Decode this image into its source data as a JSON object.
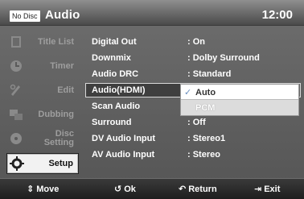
{
  "header": {
    "disc_status": "No Disc",
    "title": "Audio",
    "clock": "12:00"
  },
  "sidebar": {
    "items": [
      {
        "label": "Title List",
        "icon": "title-list-icon"
      },
      {
        "label": "Timer",
        "icon": "timer-icon"
      },
      {
        "label": "Edit",
        "icon": "edit-icon"
      },
      {
        "label": "Dubbing",
        "icon": "dubbing-icon"
      },
      {
        "label_line1": "Disc",
        "label_line2": "Setting",
        "icon": "disc-setting-icon"
      },
      {
        "label": "Setup",
        "icon": "gear-icon",
        "active": true
      }
    ]
  },
  "menu": {
    "rows": [
      {
        "key": "Digital Out",
        "value": ": On"
      },
      {
        "key": "Downmix",
        "value": ": Dolby Surround"
      },
      {
        "key": "Audio DRC",
        "value": ": Standard"
      },
      {
        "key": "Audio(HDMI)",
        "value": "",
        "selected": true
      },
      {
        "key": "Scan Audio",
        "value": ""
      },
      {
        "key": "Surround",
        "value": ": Off"
      },
      {
        "key": "DV Audio Input",
        "value": ": Stereo1"
      },
      {
        "key": "AV Audio Input",
        "value": ": Stereo"
      }
    ]
  },
  "dropdown": {
    "options": [
      {
        "label": "Auto",
        "checked": true
      },
      {
        "label": "PCM",
        "checked": false
      }
    ]
  },
  "footer": {
    "move": "Move",
    "ok": "Ok",
    "return": "Return",
    "exit": "Exit"
  },
  "colors": {
    "active_sidebar_bg": "#f2f2f2",
    "check_color": "#6b8fbf"
  }
}
